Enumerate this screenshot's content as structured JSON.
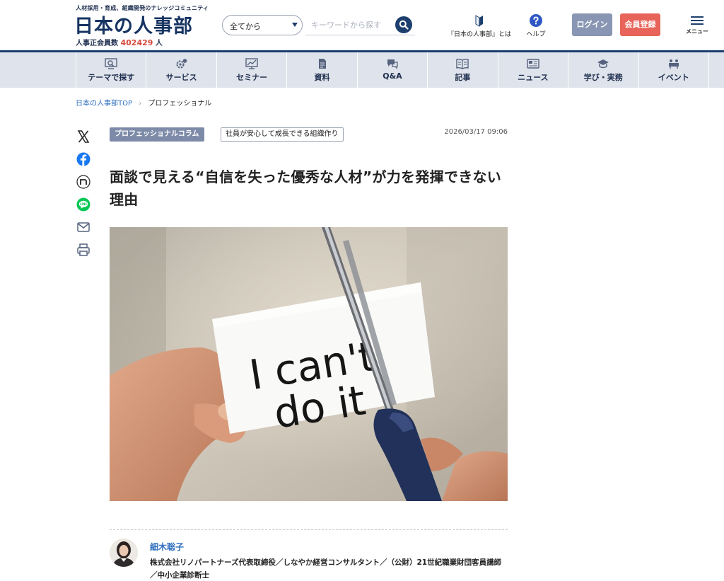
{
  "header": {
    "tagline": "人材採用・育成、組織開発のナレッジコミュニティ",
    "logo": "日本の人事部",
    "member_label": "人事正会員数",
    "member_count": "402429",
    "member_unit": "人",
    "search": {
      "category": "全てから",
      "placeholder": "キーワードから探す"
    },
    "about_label": "『日本の人事部』とは",
    "help_label": "ヘルプ",
    "login_label": "ログイン",
    "register_label": "会員登録",
    "menu_label": "メニュー"
  },
  "nav": {
    "items": [
      {
        "label": "テーマで探す",
        "icon": "theme-search-icon"
      },
      {
        "label": "サービス",
        "icon": "service-icon"
      },
      {
        "label": "セミナー",
        "icon": "seminar-icon"
      },
      {
        "label": "資料",
        "icon": "document-icon"
      },
      {
        "label": "Q&A",
        "icon": "qa-icon"
      },
      {
        "label": "記事",
        "icon": "article-icon"
      },
      {
        "label": "ニュース",
        "icon": "news-icon"
      },
      {
        "label": "学び・実務",
        "icon": "learning-icon"
      },
      {
        "label": "イベント",
        "icon": "event-icon"
      }
    ]
  },
  "breadcrumb": {
    "home": "日本の人事部TOP",
    "current": "プロフェッショナル"
  },
  "share": [
    "x-icon",
    "facebook-icon",
    "note-icon",
    "line-icon",
    "mail-icon",
    "print-icon"
  ],
  "article": {
    "tag_primary": "プロフェッショナルコラム",
    "tag_secondary": "社員が安心して成長できる組織作り",
    "date": "2026/03/17 09:06",
    "title": "面談で見える“自信を失った優秀な人材”が力を発揮できない理由",
    "hero_text_line1": "I can't",
    "hero_text_line2": "do it"
  },
  "author": {
    "name": "細木聡子",
    "description": "株式会社リノパートナーズ代表取締役／しなやか経営コンサルタント／（公財）21世紀職業財団客員講師／中小企業診断士"
  },
  "colors": {
    "brand": "#173462",
    "accent_red": "#d84a3e",
    "login": "#8896b3",
    "register": "#e8645a",
    "nav_bg": "#dfe3eb",
    "link": "#2f6fbf"
  }
}
